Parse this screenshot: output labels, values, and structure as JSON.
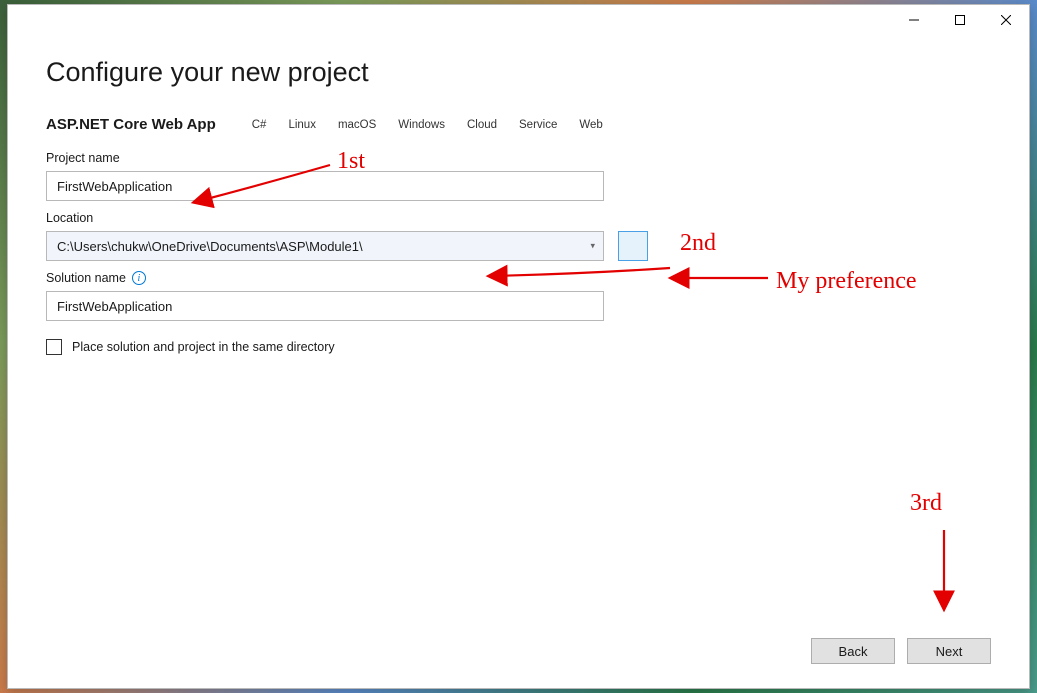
{
  "header": {
    "title": "Configure your new project"
  },
  "template": {
    "name": "ASP.NET Core Web App",
    "tags": [
      "C#",
      "Linux",
      "macOS",
      "Windows",
      "Cloud",
      "Service",
      "Web"
    ]
  },
  "fields": {
    "project_name_label": "Project name",
    "project_name_value": "FirstWebApplication",
    "location_label": "Location",
    "location_value": "C:\\Users\\chukw\\OneDrive\\Documents\\ASP\\Module1\\",
    "solution_name_label": "Solution name",
    "solution_name_value": "FirstWebApplication",
    "same_directory_label": "Place solution and project in the same directory",
    "same_directory_checked": false
  },
  "buttons": {
    "back": "Back",
    "next": "Next"
  },
  "annotations": {
    "a1": "1st",
    "a2": "2nd",
    "a3": "My preference",
    "a4": "3rd"
  }
}
